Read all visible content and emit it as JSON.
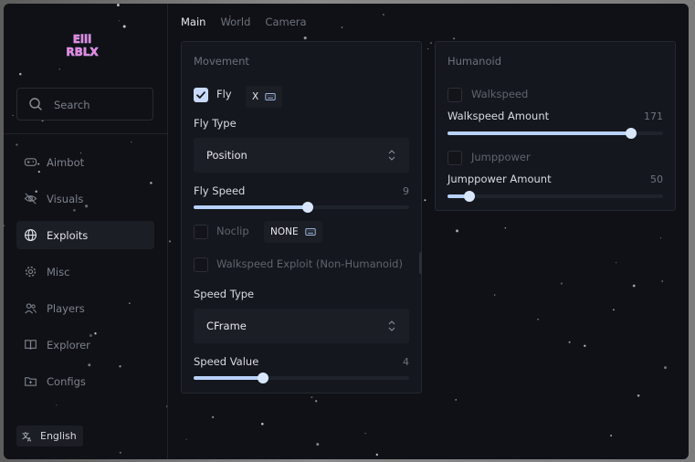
{
  "app": {
    "logo_text": "Elli RBLX"
  },
  "search": {
    "placeholder": "Search"
  },
  "sidebar": {
    "items": [
      {
        "label": "Aimbot",
        "icon": "gamepad-icon",
        "active": false
      },
      {
        "label": "Visuals",
        "icon": "eye-off-icon",
        "active": false
      },
      {
        "label": "Exploits",
        "icon": "globe-icon",
        "active": true
      },
      {
        "label": "Misc",
        "icon": "gear-icon",
        "active": false
      },
      {
        "label": "Players",
        "icon": "users-icon",
        "active": false
      },
      {
        "label": "Explorer",
        "icon": "book-icon",
        "active": false
      },
      {
        "label": "Configs",
        "icon": "folder-icon",
        "active": false
      }
    ],
    "language": "English"
  },
  "tabs": [
    {
      "label": "Main",
      "active": true
    },
    {
      "label": "World",
      "active": false
    },
    {
      "label": "Camera",
      "active": false
    }
  ],
  "movement": {
    "title": "Movement",
    "fly": {
      "label": "Fly",
      "checked": true,
      "key": "X"
    },
    "fly_type": {
      "label": "Fly Type",
      "value": "Position"
    },
    "fly_speed": {
      "label": "Fly Speed",
      "value": "9",
      "fraction": 0.53
    },
    "noclip": {
      "label": "Noclip",
      "checked": false,
      "key": "NONE"
    },
    "walkspeed_exploit": {
      "label": "Walkspeed Exploit (Non-Humanoid)",
      "checked": false
    },
    "speed_type": {
      "label": "Speed Type",
      "value": "CFrame"
    },
    "speed_value": {
      "label": "Speed Value",
      "value": "4",
      "fraction": 0.32
    }
  },
  "humanoid": {
    "title": "Humanoid",
    "walkspeed": {
      "label": "Walkspeed",
      "checked": false
    },
    "walkspeed_amount": {
      "label": "Walkspeed Amount",
      "value": "171",
      "fraction": 0.85
    },
    "jumppower": {
      "label": "Jumppower",
      "checked": false
    },
    "jumppower_amount": {
      "label": "Jumppower Amount",
      "value": "50",
      "fraction": 0.1
    }
  },
  "colors": {
    "accent": "#b8d2fb",
    "window_bg": "#0f1116",
    "panel_bg": "#14171d",
    "logo_pink": "#f07fd0"
  }
}
